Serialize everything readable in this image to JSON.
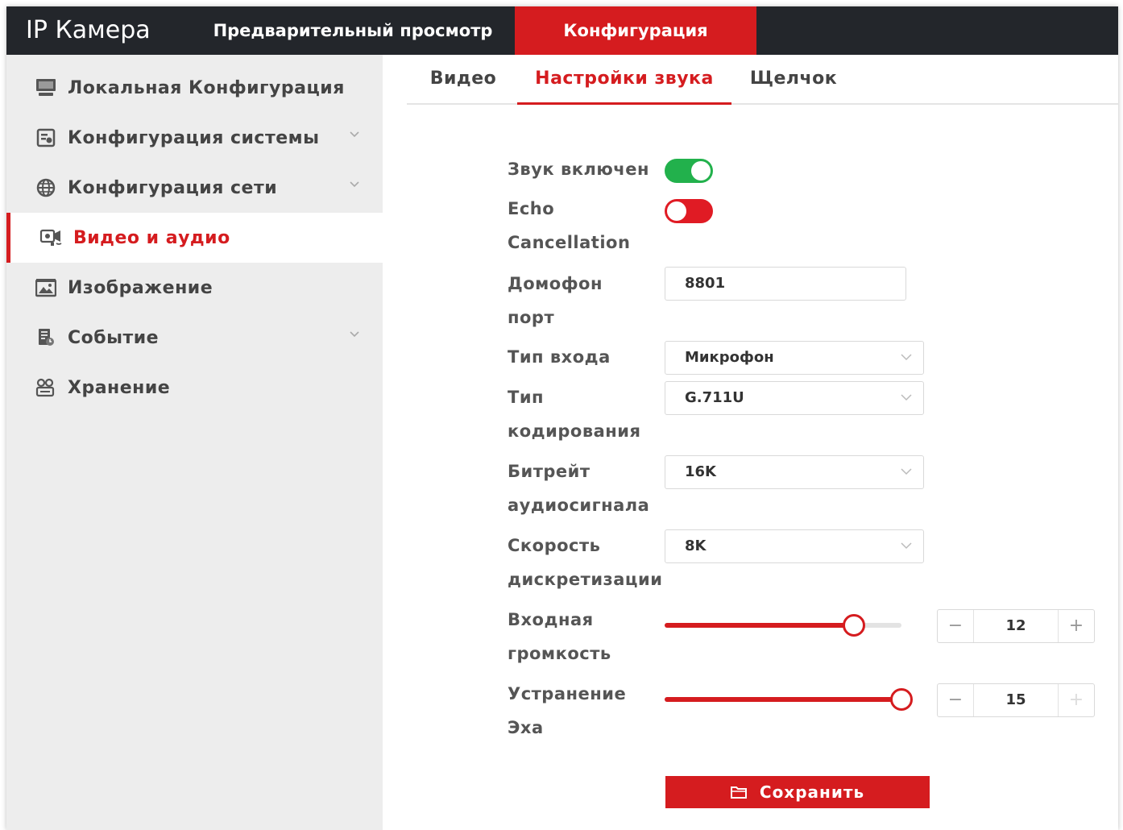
{
  "app": {
    "title": "IP Камера"
  },
  "topnav": {
    "preview": "Предварительный просмотр",
    "config": "Конфигурация"
  },
  "sidebar": {
    "items": [
      {
        "label": "Локальная Конфигурация",
        "icon": "monitor-icon",
        "expandable": false,
        "active": false
      },
      {
        "label": "Конфигурация системы",
        "icon": "system-icon",
        "expandable": true,
        "active": false
      },
      {
        "label": "Конфигурация сети",
        "icon": "globe-icon",
        "expandable": true,
        "active": false
      },
      {
        "label": "Видео и аудио",
        "icon": "video-audio-icon",
        "expandable": false,
        "active": true
      },
      {
        "label": "Изображение",
        "icon": "image-icon",
        "expandable": false,
        "active": false
      },
      {
        "label": "Событие",
        "icon": "event-icon",
        "expandable": true,
        "active": false
      },
      {
        "label": "Хранение",
        "icon": "storage-icon",
        "expandable": false,
        "active": false
      }
    ]
  },
  "tabs": [
    {
      "label": "Видео",
      "active": false
    },
    {
      "label": "Настройки звука",
      "active": true
    },
    {
      "label": "Щелчок",
      "active": false
    }
  ],
  "form": {
    "sound_enabled": {
      "label": "Звук включен",
      "value": true
    },
    "echo_cancel": {
      "label_line1": "Echo",
      "label_line2": "Cancellation",
      "value": false
    },
    "intercom_port": {
      "label_line1": "Домофон",
      "label_line2": "порт",
      "value": "8801"
    },
    "input_type": {
      "label": "Тип входа",
      "value": "Микрофон"
    },
    "encoding": {
      "label_line1": "Тип",
      "label_line2": "кодирования",
      "value": "G.711U"
    },
    "bitrate": {
      "label_line1": "Битрейт",
      "label_line2": "аудиосигнала",
      "value": "16K"
    },
    "sample_rate": {
      "label_line1": "Скорость",
      "label_line2": "дискретизации",
      "value": "8K"
    },
    "input_volume": {
      "label_line1": "Входная",
      "label_line2": "громкость",
      "value": "12",
      "level": 0.8
    },
    "echo_removal": {
      "label_line1": "Устранение",
      "label_line2": "Эха",
      "value": "15",
      "level": 1.0
    }
  },
  "stepper": {
    "minus": "−",
    "plus": "+"
  },
  "save": {
    "label": "Сохранить"
  },
  "colors": {
    "accent": "#d51c1f",
    "toggle_on": "#22b14c",
    "toggle_off": "#e01b24",
    "topbar": "#23262b",
    "sidebar": "#ededed"
  }
}
